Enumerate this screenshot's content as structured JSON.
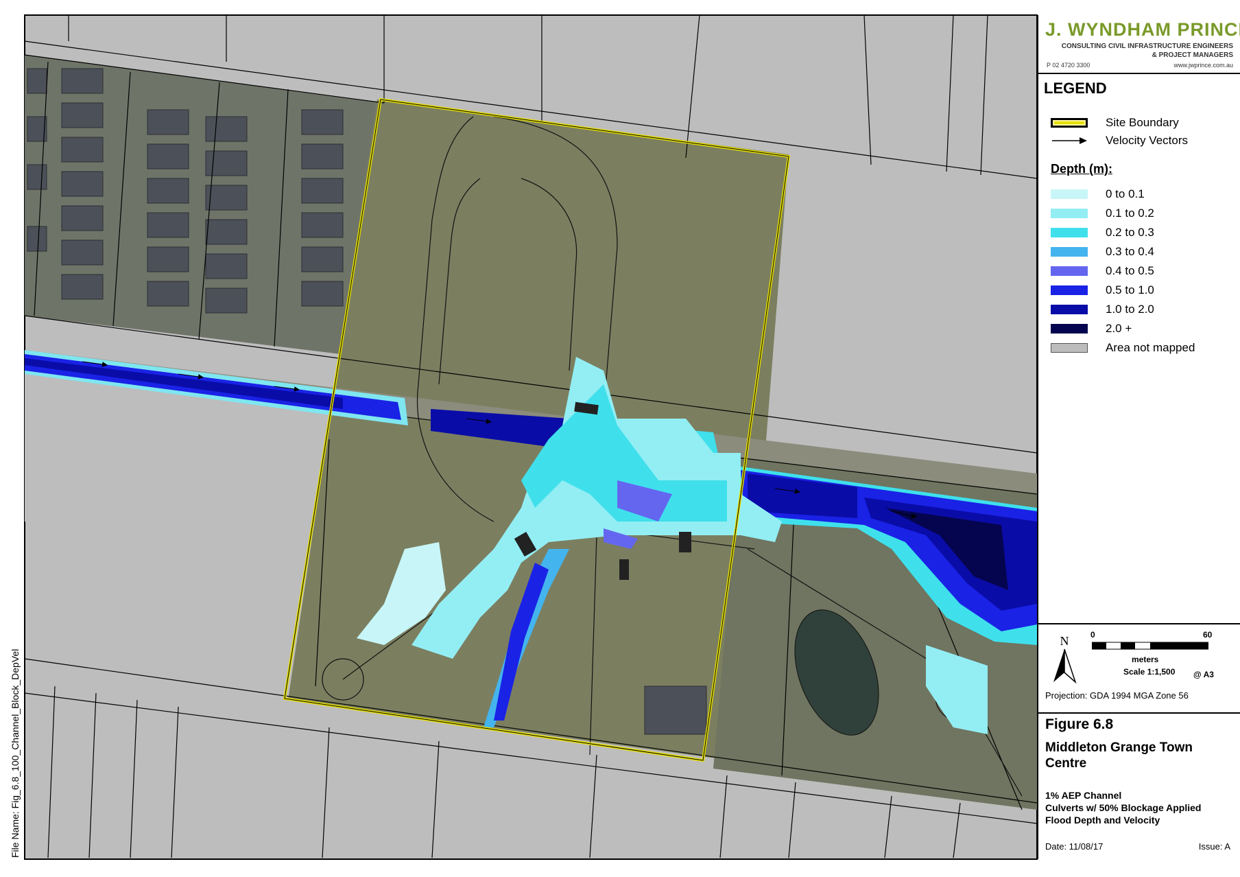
{
  "file_name": "File Name: Fig_6.8_100_Channel_Block_DepVel",
  "company": {
    "name": "J. WYNDHAM PRINCE",
    "tagline_line1": "CONSULTING CIVIL INFRASTRUCTURE ENGINEERS",
    "tagline_line2": "& PROJECT MANAGERS",
    "phone": "P 02 4720 3300",
    "website": "www.jwprince.com.au"
  },
  "legend": {
    "title": "LEGEND",
    "site_boundary": "Site Boundary",
    "velocity_vectors": "Velocity Vectors",
    "depth_title": "Depth (m):",
    "depth_classes": [
      {
        "label": "0 to 0.1",
        "color": "#c8f6f8"
      },
      {
        "label": "0.1 to 0.2",
        "color": "#93eef4"
      },
      {
        "label": "0.2 to 0.3",
        "color": "#3fe0ec"
      },
      {
        "label": "0.3 to 0.4",
        "color": "#44b4ee"
      },
      {
        "label": "0.4 to 0.5",
        "color": "#6466f0"
      },
      {
        "label": "0.5 to 1.0",
        "color": "#1a22e6"
      },
      {
        "label": "1.0 to 2.0",
        "color": "#0a0ca8"
      },
      {
        "label": "2.0 +",
        "color": "#05044e"
      }
    ],
    "not_mapped": {
      "label": "Area not mapped",
      "color": "#bdbdbd"
    }
  },
  "scale": {
    "north": "N",
    "start": "0",
    "end": "60",
    "units": "meters",
    "ratio": "Scale 1:1,500",
    "paper": "@ A3"
  },
  "projection": "Projection: GDA 1994 MGA Zone 56",
  "title_block": {
    "figure": "Figure 6.8",
    "project": "Middleton Grange Town Centre",
    "description_lines": [
      "1% AEP Channel",
      "Culverts w/ 50% Blockage Applied",
      "Flood Depth and Velocity"
    ],
    "date": "Date: 11/08/17",
    "issue": "Issue: A"
  }
}
